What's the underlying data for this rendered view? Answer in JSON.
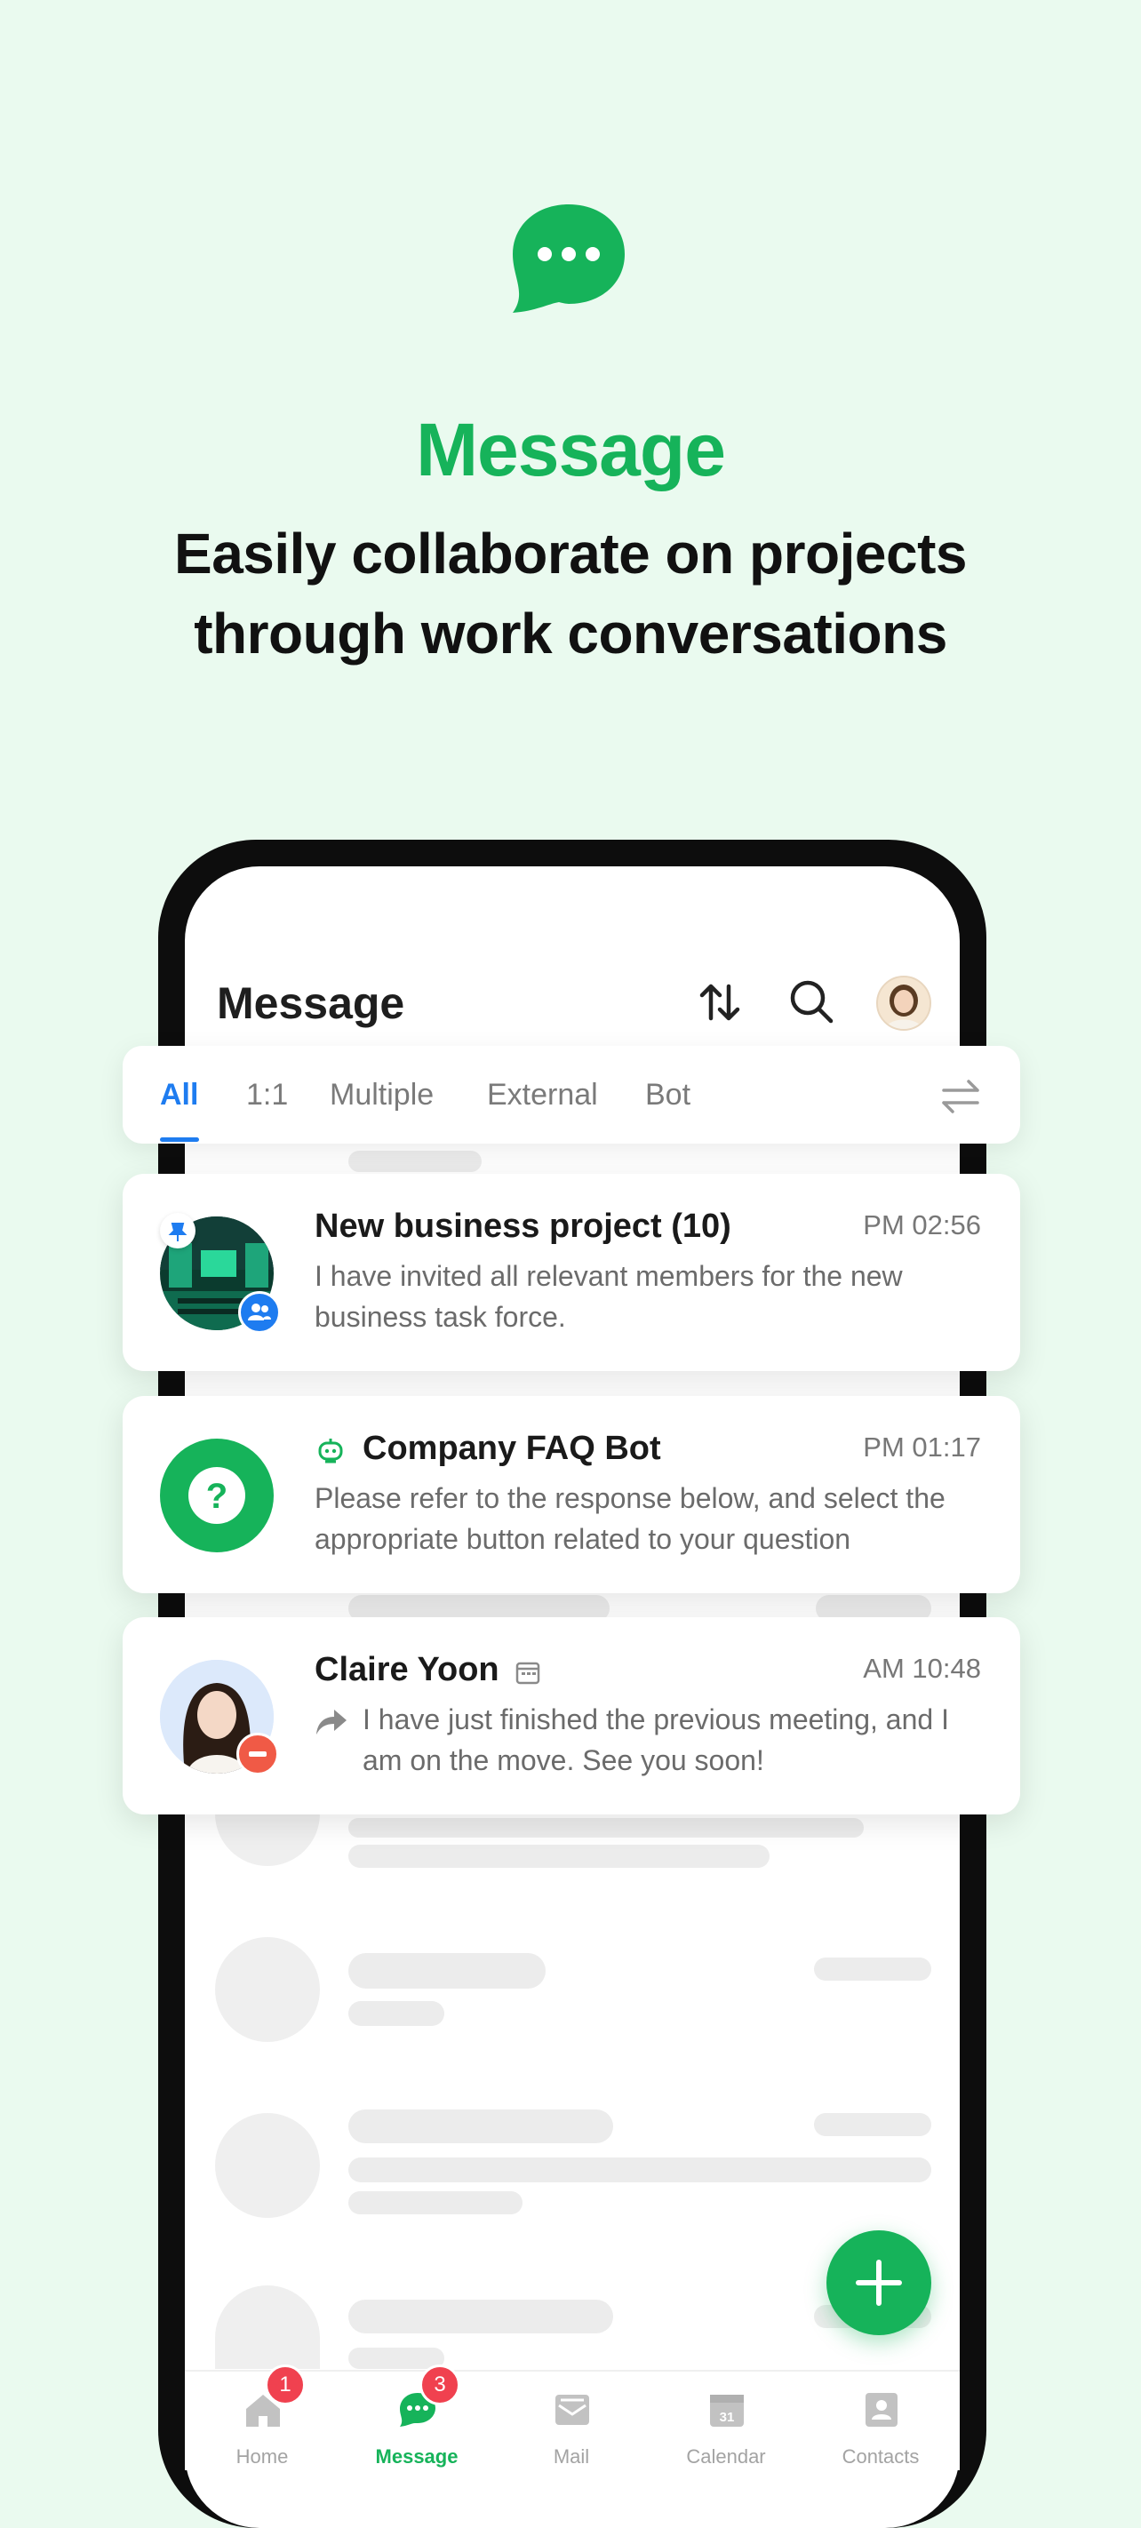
{
  "hero": {
    "title": "Message",
    "subtitle_line1": "Easily collaborate on projects",
    "subtitle_line2": "through work conversations",
    "icon": "chat-bubble-icon"
  },
  "app": {
    "title": "Message",
    "icons": [
      "sort-icon",
      "search-icon",
      "profile-avatar"
    ]
  },
  "tabs": [
    {
      "label": "All",
      "active": true
    },
    {
      "label": "1:1",
      "active": false
    },
    {
      "label": "Multiple",
      "active": false
    },
    {
      "label": "External",
      "active": false
    },
    {
      "label": "Bot",
      "active": false
    }
  ],
  "messages": [
    {
      "name": "New business project (10)",
      "time": "PM 02:56",
      "preview": "I have invited all relevant members for the new business task force."
    },
    {
      "name": "Company FAQ Bot",
      "time": "PM 01:17",
      "preview": "Please refer to the response below, and select the appropriate button related to your question"
    },
    {
      "name": "Claire Yoon",
      "time": "AM 10:48",
      "preview": "I have just finished the previous meeting, and I am on the move. See you soon!"
    }
  ],
  "nav": [
    {
      "label": "Home",
      "badge": "1"
    },
    {
      "label": "Message",
      "badge": "3",
      "active": true
    },
    {
      "label": "Mail",
      "badge": ""
    },
    {
      "label": "Calendar",
      "badge": "",
      "icon_text": "31"
    },
    {
      "label": "Contacts",
      "badge": ""
    }
  ],
  "colors": {
    "brand_green": "#16b35a",
    "active_blue": "#1e7cf0",
    "badge_red": "#f0414f",
    "background": "#eafaef"
  }
}
